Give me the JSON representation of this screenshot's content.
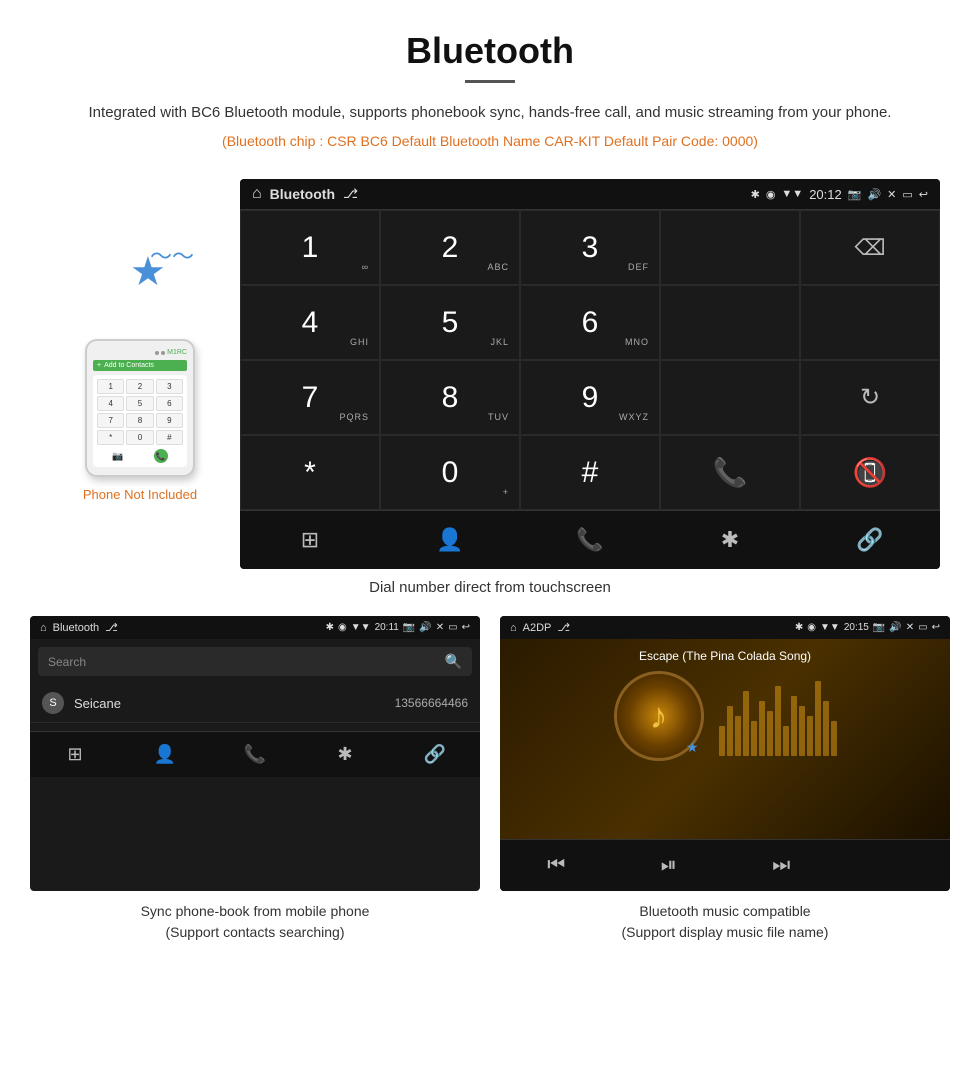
{
  "header": {
    "title": "Bluetooth",
    "description": "Integrated with BC6 Bluetooth module, supports phonebook sync, hands-free call, and music streaming from your phone.",
    "specs": "(Bluetooth chip : CSR BC6    Default Bluetooth Name CAR-KIT    Default Pair Code: 0000)"
  },
  "phone_sidebar": {
    "not_included_label": "Phone Not Included",
    "bluetooth_icon": "⬡"
  },
  "head_unit": {
    "status_bar": {
      "home_icon": "⌂",
      "title": "Bluetooth",
      "usb_icon": "⎇",
      "bt_icon": "✱",
      "location_icon": "◉",
      "signal_icon": "▼",
      "time": "20:12",
      "camera_icon": "📷",
      "volume_icon": "🔊",
      "close_icon": "✕",
      "window_icon": "▭",
      "back_icon": "↩"
    },
    "dial_keys": [
      {
        "num": "1",
        "sub": "∞"
      },
      {
        "num": "2",
        "sub": "ABC"
      },
      {
        "num": "3",
        "sub": "DEF"
      },
      {
        "num": "",
        "sub": ""
      },
      {
        "num": "⌫",
        "sub": ""
      },
      {
        "num": "4",
        "sub": "GHI"
      },
      {
        "num": "5",
        "sub": "JKL"
      },
      {
        "num": "6",
        "sub": "MNO"
      },
      {
        "num": "",
        "sub": ""
      },
      {
        "num": "",
        "sub": ""
      },
      {
        "num": "7",
        "sub": "PQRS"
      },
      {
        "num": "8",
        "sub": "TUV"
      },
      {
        "num": "9",
        "sub": "WXYZ"
      },
      {
        "num": "",
        "sub": ""
      },
      {
        "num": "↻",
        "sub": ""
      },
      {
        "num": "*",
        "sub": ""
      },
      {
        "num": "0",
        "sub": "+"
      },
      {
        "num": "#",
        "sub": ""
      },
      {
        "num": "📞",
        "sub": ""
      },
      {
        "num": "📵",
        "sub": ""
      }
    ],
    "bottom_icons": [
      "⊞",
      "👤",
      "📞",
      "✱",
      "🔗"
    ]
  },
  "dial_caption": "Dial number direct from touchscreen",
  "phonebook_panel": {
    "status": {
      "home_icon": "⌂",
      "title": "Bluetooth",
      "usb_icon": "⎇",
      "bt_icon": "✱",
      "location_icon": "◉",
      "signal_icon": "▼",
      "time": "20:11",
      "camera_icon": "📷",
      "volume_icon": "🔊",
      "close_icon": "✕",
      "window_icon": "▭",
      "back_icon": "↩"
    },
    "search_placeholder": "Search",
    "contacts": [
      {
        "letter": "S",
        "name": "Seicane",
        "number": "13566664466"
      }
    ],
    "bottom_icons": [
      "⊞",
      "👤",
      "📞",
      "✱",
      "🔗"
    ]
  },
  "music_panel": {
    "status": {
      "home_icon": "⌂",
      "title": "A2DP",
      "usb_icon": "⎇",
      "bt_icon": "✱",
      "location_icon": "◉",
      "signal_icon": "▼",
      "time": "20:15",
      "camera_icon": "📷",
      "volume_icon": "🔊",
      "close_icon": "✕",
      "window_icon": "▭",
      "back_icon": "↩"
    },
    "song_title": "Escape (The Pina Colada Song)",
    "note_icon": "♪",
    "controls": [
      "⏮",
      "⏯",
      "⏭"
    ]
  },
  "captions": {
    "phonebook": "Sync phone-book from mobile phone\n(Support contacts searching)",
    "music": "Bluetooth music compatible\n(Support display music file name)"
  }
}
